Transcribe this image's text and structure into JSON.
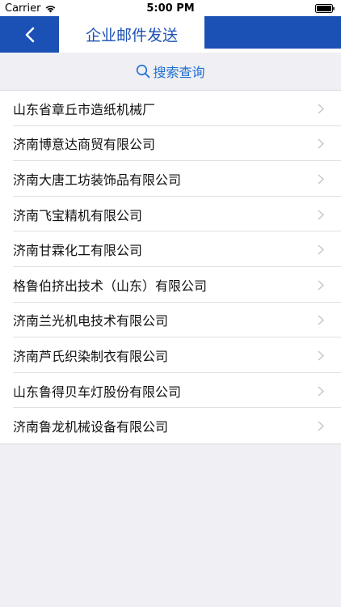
{
  "status_bar": {
    "carrier": "Carrier",
    "time": "5:00 PM"
  },
  "nav": {
    "title": "企业邮件发送"
  },
  "search": {
    "label": "搜索查询"
  },
  "companies": [
    "山东省章丘市造纸机械厂",
    "济南博意达商贸有限公司",
    "济南大唐工坊装饰品有限公司",
    "济南飞宝精机有限公司",
    "济南甘霖化工有限公司",
    "格鲁伯挤出技术（山东）有限公司",
    "济南兰光机电技术有限公司",
    "济南芦氏织染制衣有限公司",
    "山东鲁得贝车灯股份有限公司",
    "济南鲁龙机械设备有限公司"
  ],
  "colors": {
    "accent": "#1b50b4",
    "search_text": "#1f6fd3",
    "background": "#efeff4"
  },
  "icons": {
    "back": "chevron-left-icon",
    "search": "search-icon",
    "row": "chevron-right-icon",
    "wifi": "wifi-icon",
    "battery": "battery-icon"
  }
}
